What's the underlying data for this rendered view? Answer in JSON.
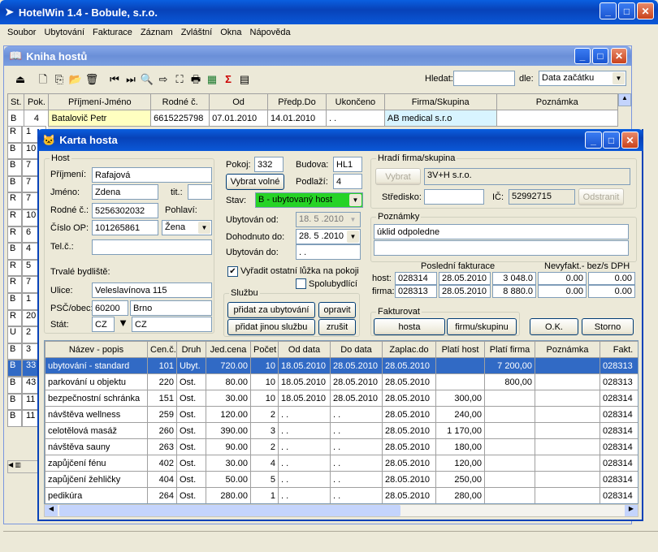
{
  "app": {
    "title": "HotelWin 1.4 - Bobule, s.r.o."
  },
  "menu": [
    "Soubor",
    "Ubytování",
    "Fakturace",
    "Záznam",
    "Zvláštní",
    "Okna",
    "Nápověda"
  ],
  "guestbook": {
    "title": "Kniha hostů",
    "search_label": "Hledat:",
    "by_label": "dle:",
    "by_value": "Data začátku",
    "columns": [
      "St.",
      "Pok.",
      "Příjmení-Jméno",
      "Rodné č.",
      "Od",
      "Předp.Do",
      "Ukončeno",
      "Firma/Skupina",
      "Poznámka"
    ],
    "first_row": [
      "B",
      "4",
      "Batalovič Petr",
      "6615225798",
      "07.01.2010",
      "14.01.2010",
      ". .",
      "AB medical s.r.o",
      ""
    ],
    "left_col_st": [
      "R",
      "B",
      "B",
      "B",
      "R",
      "R",
      "R",
      "B",
      "R",
      "R",
      "B",
      "R",
      "U",
      "B",
      "B",
      "B",
      "B",
      "B",
      "B",
      "B"
    ],
    "left_col_pok": [
      "1",
      "10",
      "7",
      "7",
      "7",
      "10",
      "6",
      "4",
      "5",
      "7",
      "1",
      "20",
      "2",
      "3",
      "33",
      "43",
      "11",
      "11"
    ]
  },
  "card": {
    "title": "Karta hosta",
    "host_group": "Host",
    "surname_label": "Příjmení:",
    "surname": "Rafajová",
    "name_label": "Jméno:",
    "name": "Zdena",
    "title_label": "tit.:",
    "title_value": "",
    "birth_label": "Rodné č.:",
    "birth": "5256302032",
    "gender_label": "Pohlaví:",
    "gender": "Žena",
    "op_label": "Číslo OP:",
    "op": "101265861",
    "phone_label": "Tel.č.:",
    "phone": "",
    "residence_label": "Trvalé bydliště:",
    "street_label": "Ulice:",
    "street": "Veleslavínova 115",
    "zip_label": "PSČ/obec:",
    "zip": "60200",
    "city": "Brno",
    "state_label": "Stát:",
    "state_code": "CZ",
    "state": "CZ",
    "room_label": "Pokoj:",
    "room": "332",
    "building_label": "Budova:",
    "building": "HL1",
    "free_btn": "Vybrat volné",
    "floor_label": "Podlaží:",
    "floor": "4",
    "status_label": "Stav:",
    "status": "B - ubytovaný host",
    "from_label": "Ubytován od:",
    "from": "18. 5 .2010",
    "agreed_label": "Dohodnuto do:",
    "agreed": "28. 5 .2010",
    "to_label": "Ubytován do:",
    "to": ". .",
    "chk1_label": "Vyřadit ostatní lůžka na pokoji",
    "chk2_label": "Spolubydlící",
    "services_group": "Službu",
    "btn_add_stay": "přidat za ubytování",
    "btn_edit": "opravit",
    "btn_add_other": "přidat jinou službu",
    "btn_cancel_srv": "zrušit",
    "payer_group": "Hradí firma/skupina",
    "btn_choose": "Vybrat",
    "company": "3V+H s.r.o.",
    "center_label": "Středisko:",
    "center": "",
    "ic_label": "IČ:",
    "ic": "52992715",
    "btn_remove": "Odstranit",
    "notes_group": "Poznámky",
    "notes": "úklid odpoledne",
    "last_invoice_label": "Poslední fakturace",
    "uninvoiced_label": "Nevyfakt.- bez/s DPH",
    "host_label": "host:",
    "firm_label": "firma:",
    "host_inv": [
      "028314",
      "28.05.2010",
      "3 048.0",
      "0.00",
      "0.00"
    ],
    "firm_inv": [
      "028313",
      "28.05.2010",
      "8 880.0",
      "0.00",
      "0.00"
    ],
    "invoice_group": "Fakturovat",
    "btn_host": "hosta",
    "btn_firm": "firmu/skupinu",
    "btn_ok": "O.K.",
    "btn_storno": "Storno",
    "svc_columns": [
      "Název - popis",
      "Cen.č.",
      "Druh",
      "Jed.cena",
      "Počet",
      "Od data",
      "Do data",
      "Zaplac.do",
      "Platí host",
      "Platí firma",
      "Poznámka",
      "Fakt."
    ],
    "svc_rows": [
      [
        "ubytování - standard",
        "101",
        "Ubyt.",
        "720.00",
        "10",
        "18.05.2010",
        "28.05.2010",
        "28.05.2010",
        "",
        "7 200,00",
        "",
        "028313"
      ],
      [
        "parkování u objektu",
        "220",
        "Ost.",
        "80.00",
        "10",
        "18.05.2010",
        "28.05.2010",
        "28.05.2010",
        "",
        "800,00",
        "",
        "028313"
      ],
      [
        "bezpečnostní schránka",
        "151",
        "Ost.",
        "30.00",
        "10",
        "18.05.2010",
        "28.05.2010",
        "28.05.2010",
        "300,00",
        "",
        "",
        "028314"
      ],
      [
        "návštěva wellness",
        "259",
        "Ost.",
        "120.00",
        "2",
        ". .",
        ". .",
        "28.05.2010",
        "240,00",
        "",
        "",
        "028314"
      ],
      [
        "celotělová masáž",
        "260",
        "Ost.",
        "390.00",
        "3",
        ". .",
        ". .",
        "28.05.2010",
        "1 170,00",
        "",
        "",
        "028314"
      ],
      [
        "návštěva sauny",
        "263",
        "Ost.",
        "90.00",
        "2",
        ". .",
        ". .",
        "28.05.2010",
        "180,00",
        "",
        "",
        "028314"
      ],
      [
        "zapůjčení fénu",
        "402",
        "Ost.",
        "30.00",
        "4",
        ". .",
        ". .",
        "28.05.2010",
        "120,00",
        "",
        "",
        "028314"
      ],
      [
        "zapůjčení žehličky",
        "404",
        "Ost.",
        "50.00",
        "5",
        ". .",
        ". .",
        "28.05.2010",
        "250,00",
        "",
        "",
        "028314"
      ],
      [
        "pedikúra",
        "264",
        "Ost.",
        "280.00",
        "1",
        ". .",
        ". .",
        "28.05.2010",
        "280,00",
        "",
        "",
        "028314"
      ]
    ]
  }
}
